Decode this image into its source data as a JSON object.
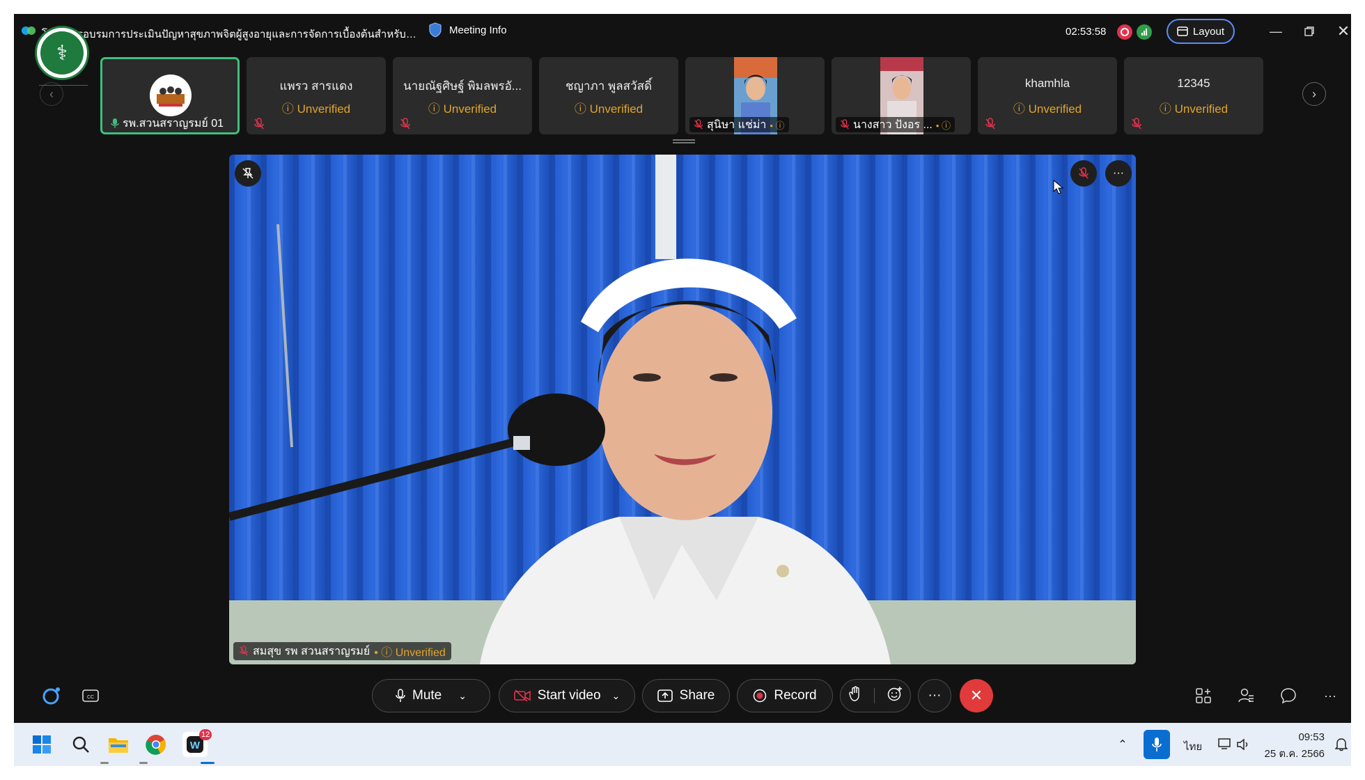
{
  "window": {
    "title": "โครงการอบรมการประเมินปัญหาสุขภาพจิตผู้สูงอายุและการจัดการเบื้องต้นสำหรับผู้...",
    "meeting_info_label": "Meeting Info",
    "timer": "02:53:58",
    "layout_label": "Layout"
  },
  "participants": [
    {
      "name": "รพ.สวนสราญรมย์ 01",
      "status": "",
      "active": true
    },
    {
      "name": "แพรว สารแดง",
      "status": "Unverified"
    },
    {
      "name": "นายณัฐศิษฐ์ พิมลพรอั...",
      "status": "Unverified"
    },
    {
      "name": "ชญาภา พูลสวัสดิ์",
      "status": "Unverified"
    },
    {
      "name": "สุนิษา แช่ม่า",
      "status": "",
      "video": true
    },
    {
      "name": "นางสาว ปังอร ...",
      "status": "",
      "video": true
    },
    {
      "name": "khamhla",
      "status": "Unverified"
    },
    {
      "name": "12345",
      "status": "Unverified"
    }
  ],
  "main_video": {
    "speaker_name": "สมสุข รพ สวนสราญรมย์",
    "speaker_status": "Unverified"
  },
  "controls": {
    "mute": "Mute",
    "start_video": "Start video",
    "share": "Share",
    "record": "Record"
  },
  "taskbar": {
    "lang": "ไทย",
    "time": "09:53",
    "date": "25 ต.ค. 2566",
    "webex_badge": "12"
  },
  "colors": {
    "accent_green": "#3fbf7f",
    "unverified": "#e0a42d",
    "end_call": "#e13a3a",
    "layout_border": "#5b8cff"
  }
}
